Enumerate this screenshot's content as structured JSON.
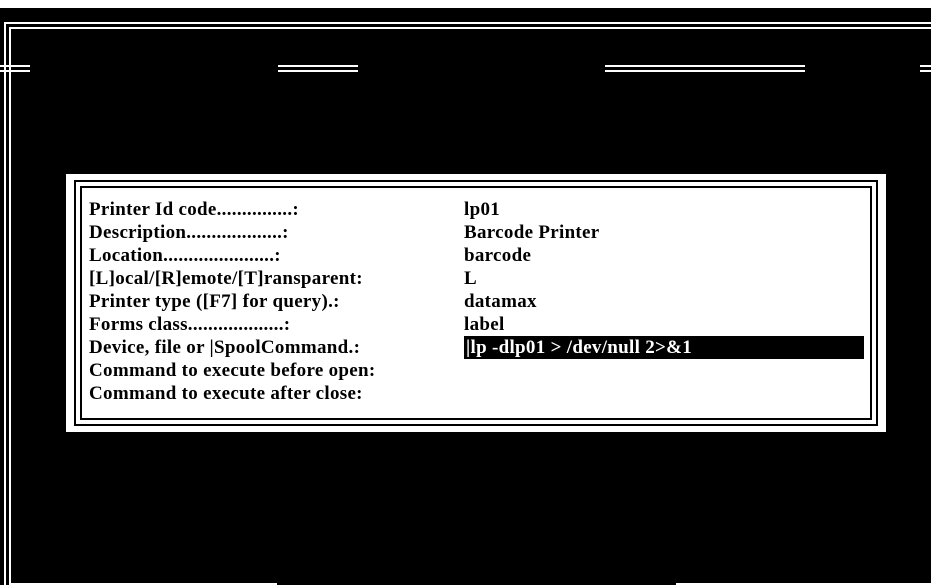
{
  "dialog": {
    "fields": [
      {
        "label": "Printer Id code...............:",
        "value": "lp01"
      },
      {
        "label": "Description...................:",
        "value": "Barcode Printer"
      },
      {
        "label": "Location......................:",
        "value": "barcode"
      },
      {
        "label": "[L]ocal/[R]emote/[T]ransparent:",
        "value": "L"
      },
      {
        "label": "Printer type ([F7] for query).:",
        "value": "datamax"
      },
      {
        "label": "Forms class...................:",
        "value": "label"
      },
      {
        "label": "Device, file or |SpoolCommand.:",
        "value": "|lp -dlp01 > /dev/null 2>&1"
      },
      {
        "label": "Command to execute before open:",
        "value": ""
      },
      {
        "label": "Command to execute after close:",
        "value": ""
      }
    ]
  },
  "colors": {
    "background": "#000000",
    "foreground": "#ffffff",
    "dialog_bg": "#ffffff",
    "dialog_text": "#000000"
  }
}
